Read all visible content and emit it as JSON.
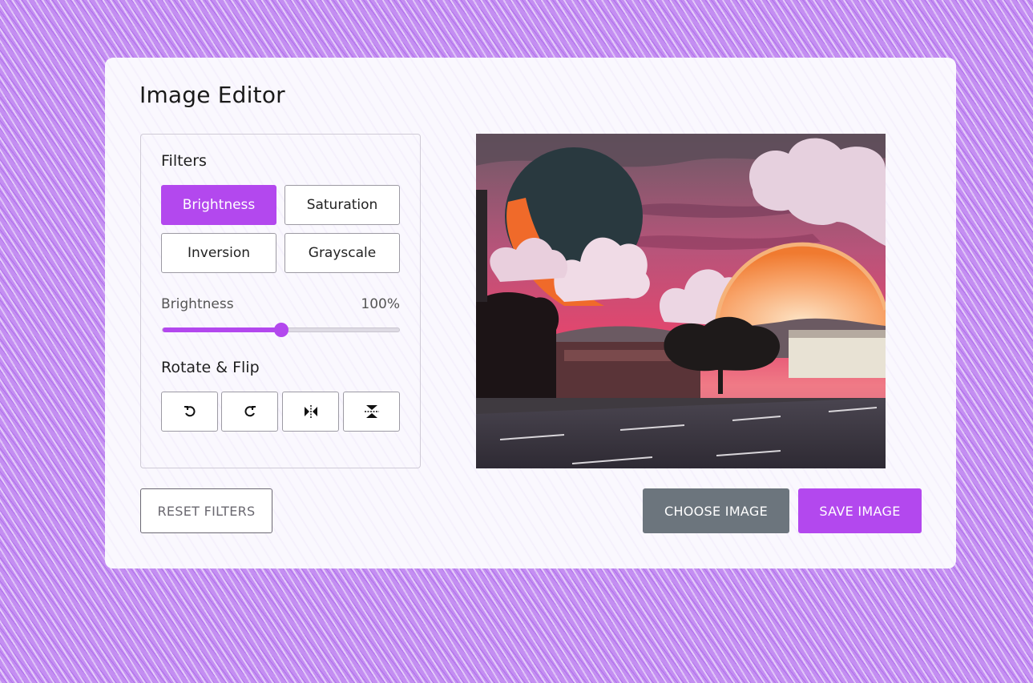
{
  "app": {
    "title": "Image Editor"
  },
  "filters": {
    "heading": "Filters",
    "options": [
      {
        "label": "Brightness",
        "active": true
      },
      {
        "label": "Saturation",
        "active": false
      },
      {
        "label": "Inversion",
        "active": false
      },
      {
        "label": "Grayscale",
        "active": false
      }
    ],
    "slider": {
      "label": "Brightness",
      "value_text": "100%",
      "value": 100,
      "max": 200
    }
  },
  "rotate_flip": {
    "heading": "Rotate & Flip",
    "buttons": [
      "rotate-left-icon",
      "rotate-right-icon",
      "flip-horizontal-icon",
      "flip-vertical-icon"
    ]
  },
  "actions": {
    "reset": "RESET FILTERS",
    "choose": "CHOOSE IMAGE",
    "save": "SAVE IMAGE"
  },
  "colors": {
    "accent": "#b348ee",
    "secondary": "#6c757d"
  }
}
